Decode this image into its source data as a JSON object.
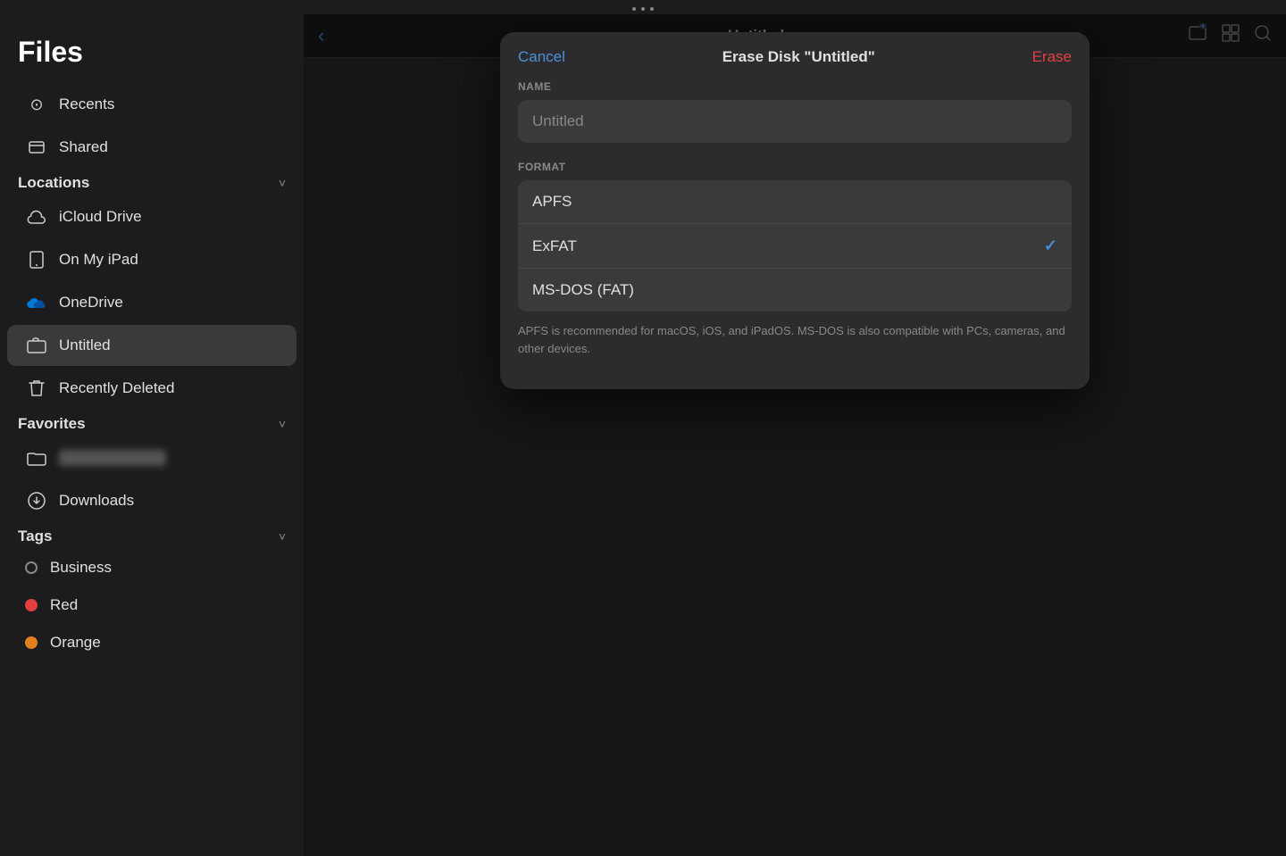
{
  "topbar": {
    "dots": 3
  },
  "sidebar": {
    "title": "Files",
    "sections": {
      "recents": {
        "label": "Recents"
      },
      "shared": {
        "label": "Shared"
      },
      "locations": {
        "label": "Locations",
        "items": [
          {
            "id": "icloud",
            "label": "iCloud Drive",
            "icon": "☁"
          },
          {
            "id": "ipad",
            "label": "On My iPad",
            "icon": "▭"
          },
          {
            "id": "onedrive",
            "label": "OneDrive",
            "icon": "☁"
          },
          {
            "id": "untitled",
            "label": "Untitled",
            "icon": "💾"
          },
          {
            "id": "recently-deleted",
            "label": "Recently Deleted",
            "icon": "🗑"
          }
        ]
      },
      "favorites": {
        "label": "Favorites",
        "items": [
          {
            "id": "blurred",
            "label": ""
          },
          {
            "id": "downloads",
            "label": "Downloads",
            "icon": "⊕"
          }
        ]
      },
      "tags": {
        "label": "Tags",
        "items": [
          {
            "id": "business",
            "label": "Business",
            "dot": "none"
          },
          {
            "id": "red",
            "label": "Red",
            "dot": "red"
          },
          {
            "id": "orange",
            "label": "Orange",
            "dot": "orange"
          }
        ]
      }
    }
  },
  "main": {
    "toolbar": {
      "back_label": "‹",
      "title": "Untitled",
      "add_label": "⊕",
      "folder_label": "📁",
      "grid_label": "⊞",
      "search_label": "⌕"
    }
  },
  "modal": {
    "cancel_label": "Cancel",
    "title": "Erase Disk \"Untitled\"",
    "erase_label": "Erase",
    "name_section_label": "NAME",
    "name_placeholder": "Untitled",
    "format_section_label": "FORMAT",
    "formats": [
      {
        "id": "apfs",
        "label": "APFS",
        "selected": false
      },
      {
        "id": "exfat",
        "label": "ExFAT",
        "selected": true
      },
      {
        "id": "msdos",
        "label": "MS-DOS (FAT)",
        "selected": false
      }
    ],
    "description": "APFS is recommended for macOS, iOS, and iPadOS. MS-DOS is also compatible with PCs, cameras, and other devices."
  }
}
